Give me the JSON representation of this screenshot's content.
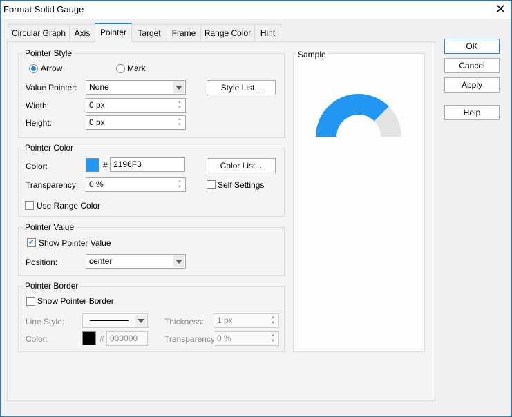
{
  "window": {
    "title": "Format Solid Gauge",
    "close": "✕"
  },
  "tabs": [
    {
      "label": "Circular Graph"
    },
    {
      "label": "Axis"
    },
    {
      "label": "Pointer",
      "active": true
    },
    {
      "label": "Target"
    },
    {
      "label": "Frame"
    },
    {
      "label": "Range Color"
    },
    {
      "label": "Hint"
    }
  ],
  "pointer_style": {
    "title": "Pointer Style",
    "arrow": "Arrow",
    "mark": "Mark",
    "selected": "Arrow",
    "value_pointer_label": "Value Pointer:",
    "value_pointer": "None",
    "style_list": "Style List...",
    "width_label": "Width:",
    "width": "0 px",
    "height_label": "Height:",
    "height": "0 px"
  },
  "pointer_color": {
    "title": "Pointer Color",
    "color_label": "Color:",
    "hash": "#",
    "color_hex": "2196F3",
    "color": "#2196F3",
    "color_list": "Color List...",
    "transparency_label": "Transparency:",
    "transparency": "0 %",
    "self_settings": "Self Settings",
    "self_settings_checked": false,
    "use_range_color": "Use Range Color",
    "use_range_color_checked": false
  },
  "pointer_value": {
    "title": "Pointer Value",
    "show": "Show Pointer Value",
    "show_checked": true,
    "position_label": "Position:",
    "position": "center"
  },
  "pointer_border": {
    "title": "Pointer Border",
    "show": "Show Pointer Border",
    "show_checked": false,
    "line_style_label": "Line Style:",
    "color_label": "Color:",
    "hash": "#",
    "color_hex": "000000",
    "color": "#000000",
    "thickness_label": "Thickness:",
    "thickness": "1 px",
    "transparency_label": "Transparency:",
    "transparency": "0 %"
  },
  "sample": {
    "title": "Sample",
    "gauge_fraction": 0.75,
    "fill_color": "#2196F3",
    "track_color": "#E4E4E4"
  },
  "buttons": {
    "ok": "OK",
    "cancel": "Cancel",
    "apply": "Apply",
    "help": "Help"
  }
}
